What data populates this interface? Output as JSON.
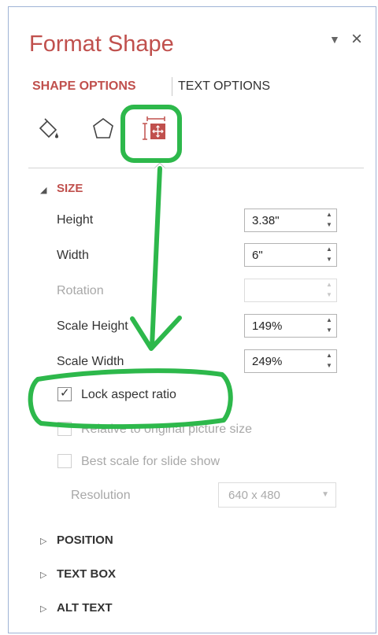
{
  "pane": {
    "title": "Format Shape",
    "menu_glyph": "▼",
    "close_glyph": "×"
  },
  "tabs": [
    {
      "label": "SHAPE OPTIONS",
      "active": true
    },
    {
      "label": "TEXT OPTIONS",
      "active": false
    }
  ],
  "icons": [
    "fill-line-icon",
    "effects-pentagon-icon",
    "size-properties-icon"
  ],
  "size_section": {
    "caret": "◢",
    "title": "SIZE",
    "fields": [
      {
        "label": "Height",
        "value": "3.38\"",
        "enabled": true
      },
      {
        "label": "Width",
        "value": "6\"",
        "enabled": true
      },
      {
        "label": "Rotation",
        "value": "",
        "enabled": false
      },
      {
        "label": "Scale Height",
        "value": "149%",
        "enabled": true
      },
      {
        "label": "Scale Width",
        "value": "249%",
        "enabled": true
      }
    ],
    "checkboxes": [
      {
        "label": "Lock aspect ratio",
        "checked": true,
        "enabled": true
      },
      {
        "label": "Relative to original picture size",
        "checked": false,
        "enabled": false
      },
      {
        "label": "Best scale for slide show",
        "checked": false,
        "enabled": false
      }
    ],
    "resolution": {
      "label": "Resolution",
      "value": "640 x 480",
      "enabled": false
    }
  },
  "collapsed_sections": [
    {
      "caret": "▷",
      "title": "POSITION"
    },
    {
      "caret": "▷",
      "title": "TEXT BOX"
    },
    {
      "caret": "▷",
      "title": "ALT TEXT"
    }
  ],
  "colors": {
    "accent": "#c0504d",
    "annotation_green": "#2db84b",
    "frame_border": "#9fb3d6"
  }
}
